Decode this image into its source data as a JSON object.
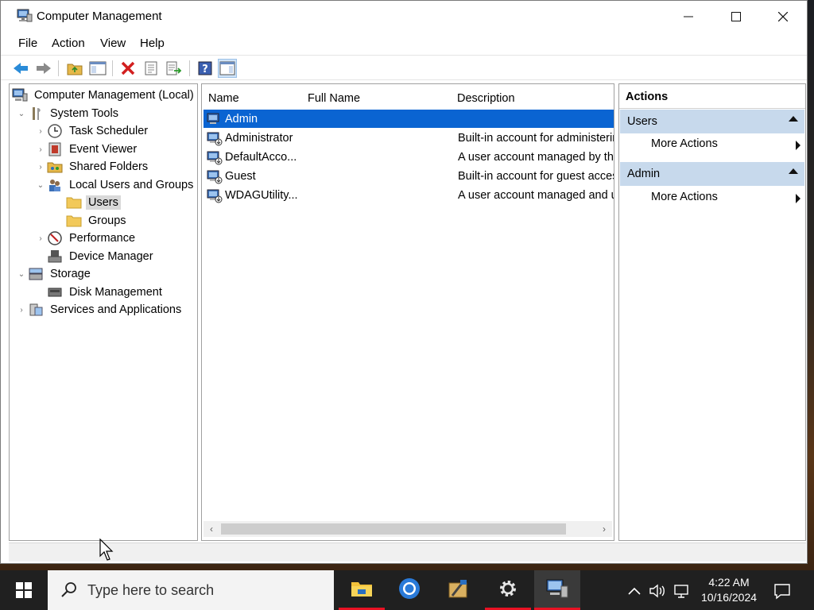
{
  "window": {
    "title": "Computer Management"
  },
  "menu": [
    "File",
    "Action",
    "View",
    "Help"
  ],
  "tree": {
    "root": "Computer Management (Local)",
    "system_tools": "System Tools",
    "task_scheduler": "Task Scheduler",
    "event_viewer": "Event Viewer",
    "shared_folders": "Shared Folders",
    "local_users_groups": "Local Users and Groups",
    "users": "Users",
    "groups": "Groups",
    "performance": "Performance",
    "device_manager": "Device Manager",
    "storage": "Storage",
    "disk_management": "Disk Management",
    "services_apps": "Services and Applications"
  },
  "list": {
    "columns": {
      "name": "Name",
      "full_name": "Full Name",
      "description": "Description"
    },
    "rows": [
      {
        "name": "Admin",
        "full_name": "",
        "description": ""
      },
      {
        "name": "Administrator",
        "full_name": "",
        "description": "Built-in account for administering the computer/domain"
      },
      {
        "name": "DefaultAcco...",
        "full_name": "",
        "description": "A user account managed by the system."
      },
      {
        "name": "Guest",
        "full_name": "",
        "description": "Built-in account for guest access to the computer/domain"
      },
      {
        "name": "WDAGUtility...",
        "full_name": "",
        "description": "A user account managed and used by the system for Windows Defender Application Guard scenarios."
      }
    ]
  },
  "actions": {
    "title": "Actions",
    "sections": [
      {
        "label": "Users",
        "item": "More Actions"
      },
      {
        "label": "Admin",
        "item": "More Actions"
      }
    ]
  },
  "taskbar": {
    "search_placeholder": "Type here to search",
    "time": "4:22 AM",
    "date": "10/16/2024"
  },
  "colors": {
    "selection": "#0a64d2",
    "actions_header": "#c7d9ec",
    "taskbar": "#202020"
  }
}
